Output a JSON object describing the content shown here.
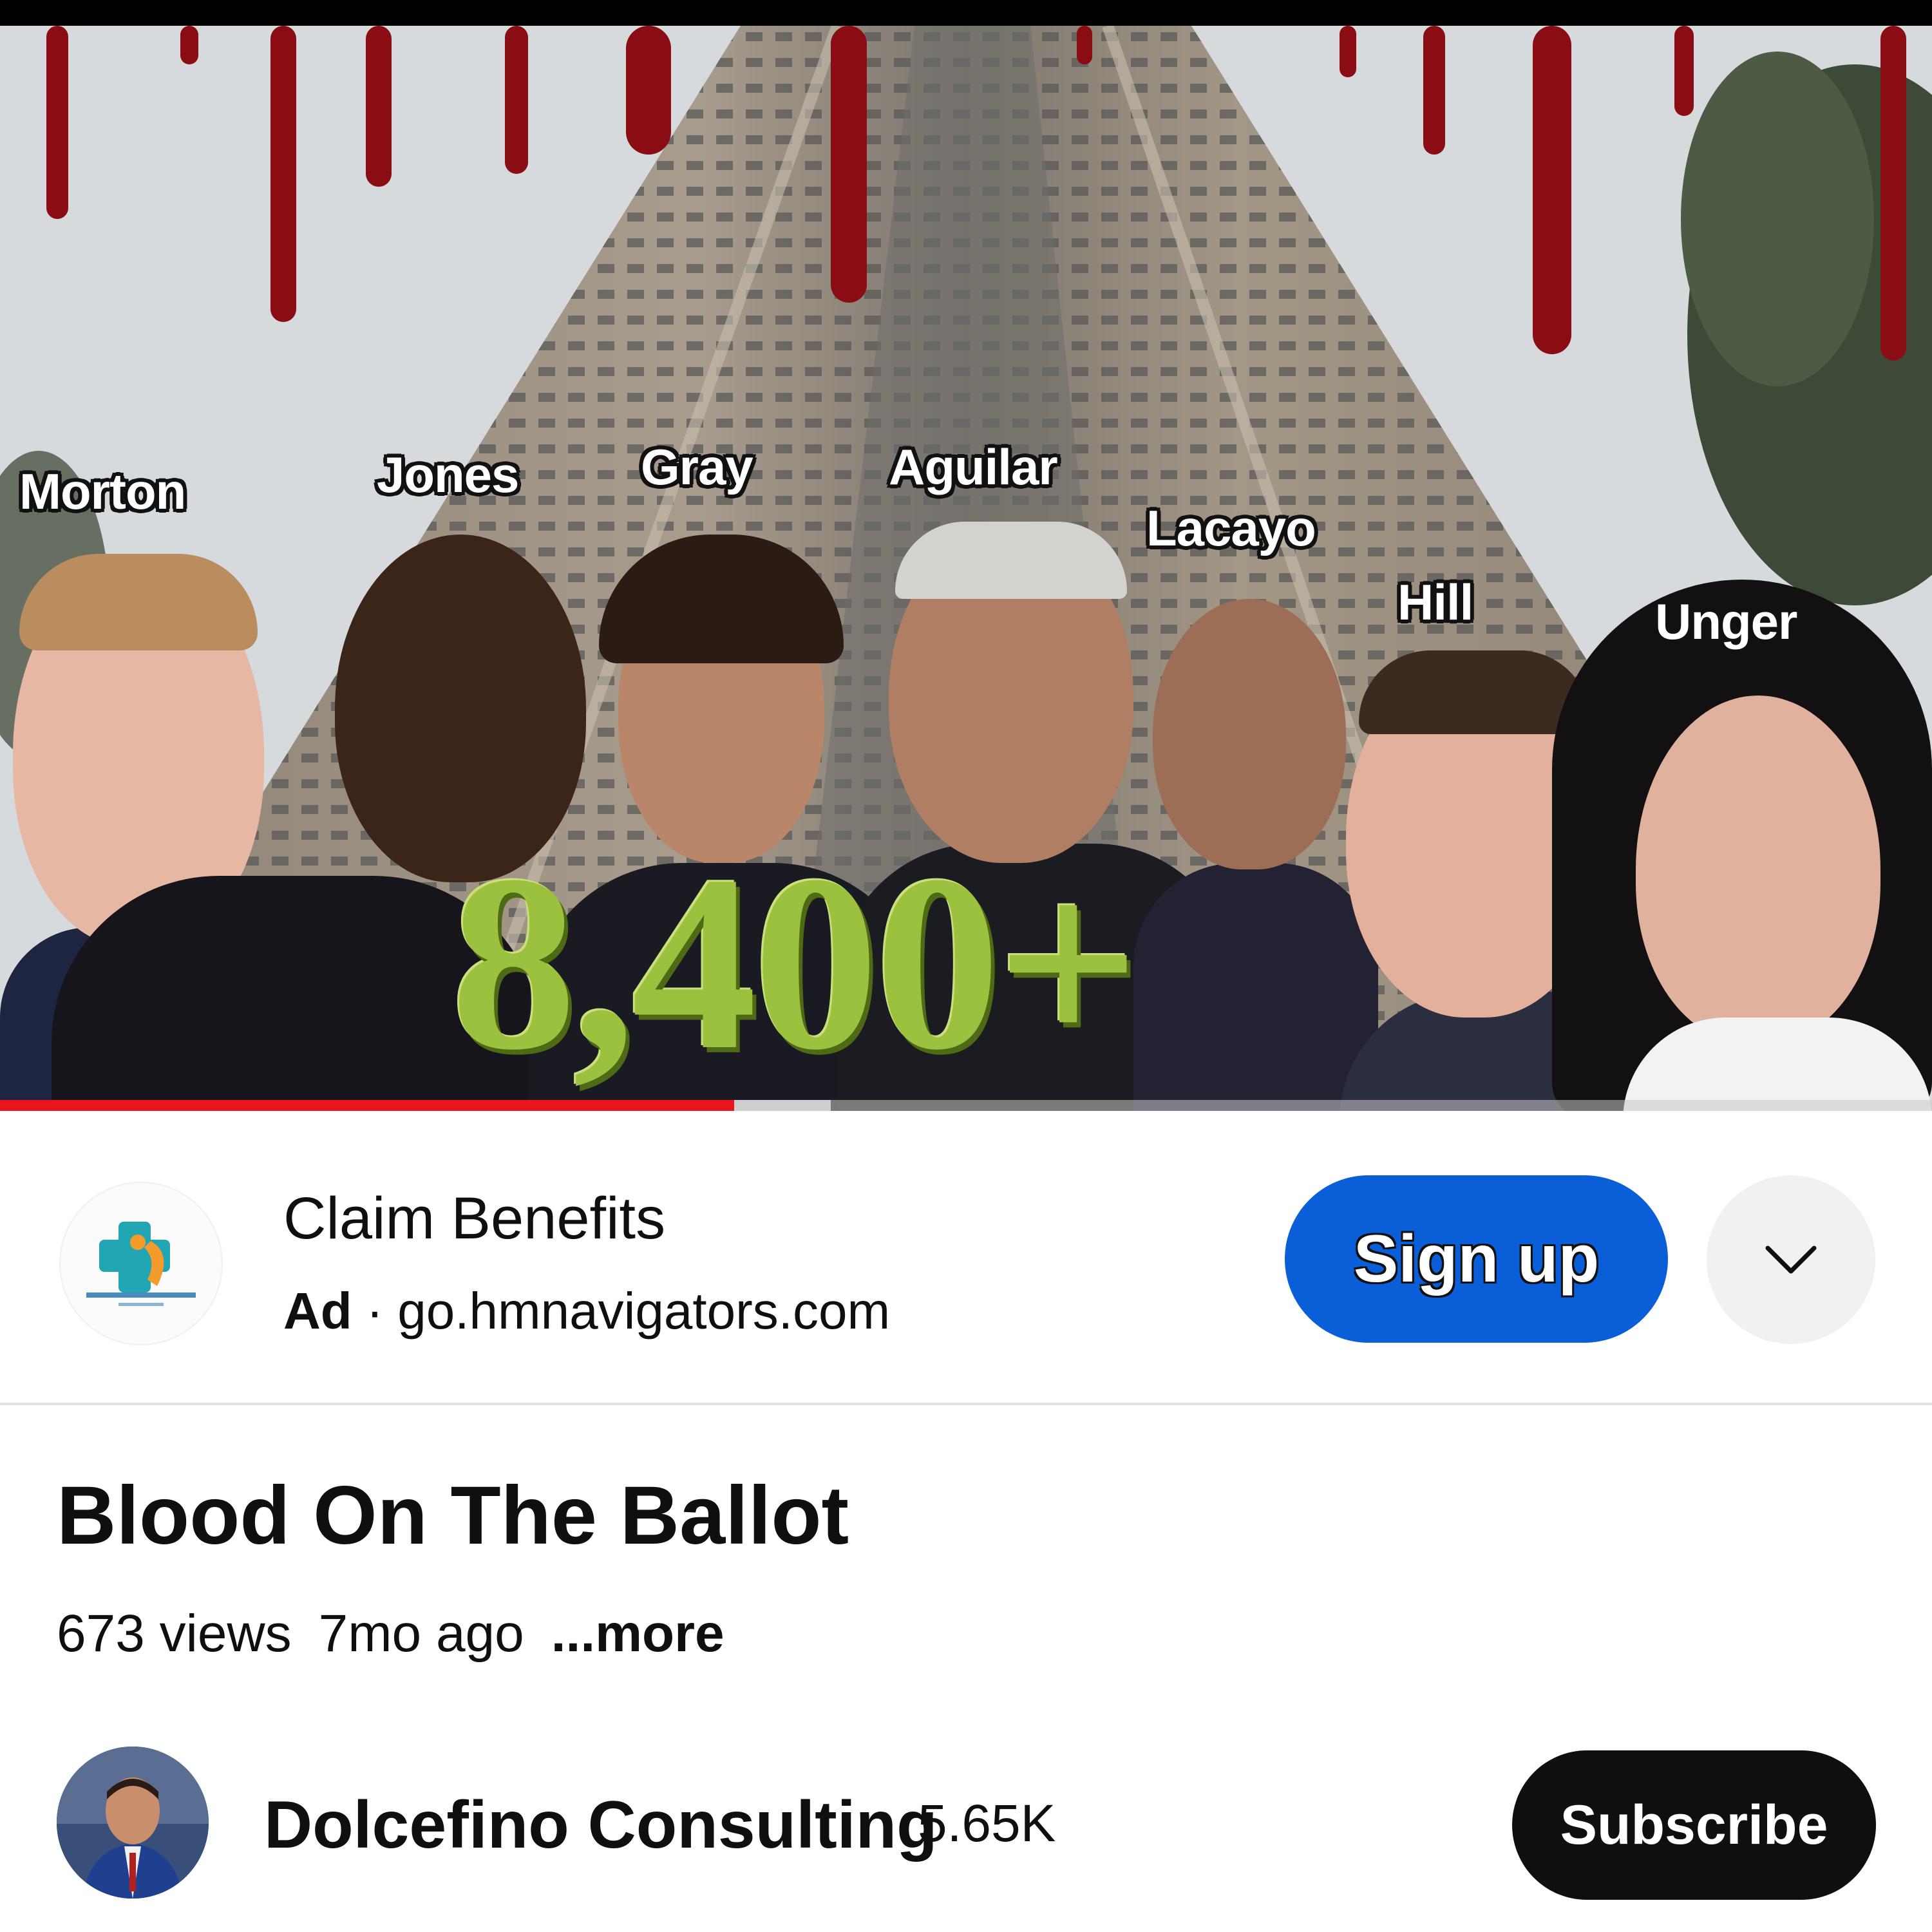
{
  "video": {
    "thumbnail": {
      "overlay_number": "8,400+",
      "name_labels": [
        "Morton",
        "Jones",
        "Gray",
        "Aguilar",
        "Lacayo",
        "Hill",
        "Unger"
      ]
    },
    "progress_fraction": 0.38,
    "buffered_fraction": 0.43
  },
  "ad": {
    "advertiser": "Claim Benefits",
    "badge": "Ad",
    "separator": "·",
    "domain": "go.hmnavigators.com",
    "cta_label": "Sign up",
    "expand_icon": "chevron-down-icon",
    "logo_icon": "medical-cross-logo"
  },
  "info": {
    "title": "Blood On The Ballot",
    "views": "673 views",
    "age": "7mo ago",
    "more_label": "...more"
  },
  "channel": {
    "name": "Dolcefino Consulting",
    "subscribers": "5.65K",
    "subscribe_label": "Subscribe"
  },
  "colors": {
    "progress": "#e8141e",
    "signup_button": "#0a5fd9",
    "subscribe_button": "#0f0f0f",
    "overlay_number": "#9cc13f",
    "blood": "#8b0d14"
  }
}
